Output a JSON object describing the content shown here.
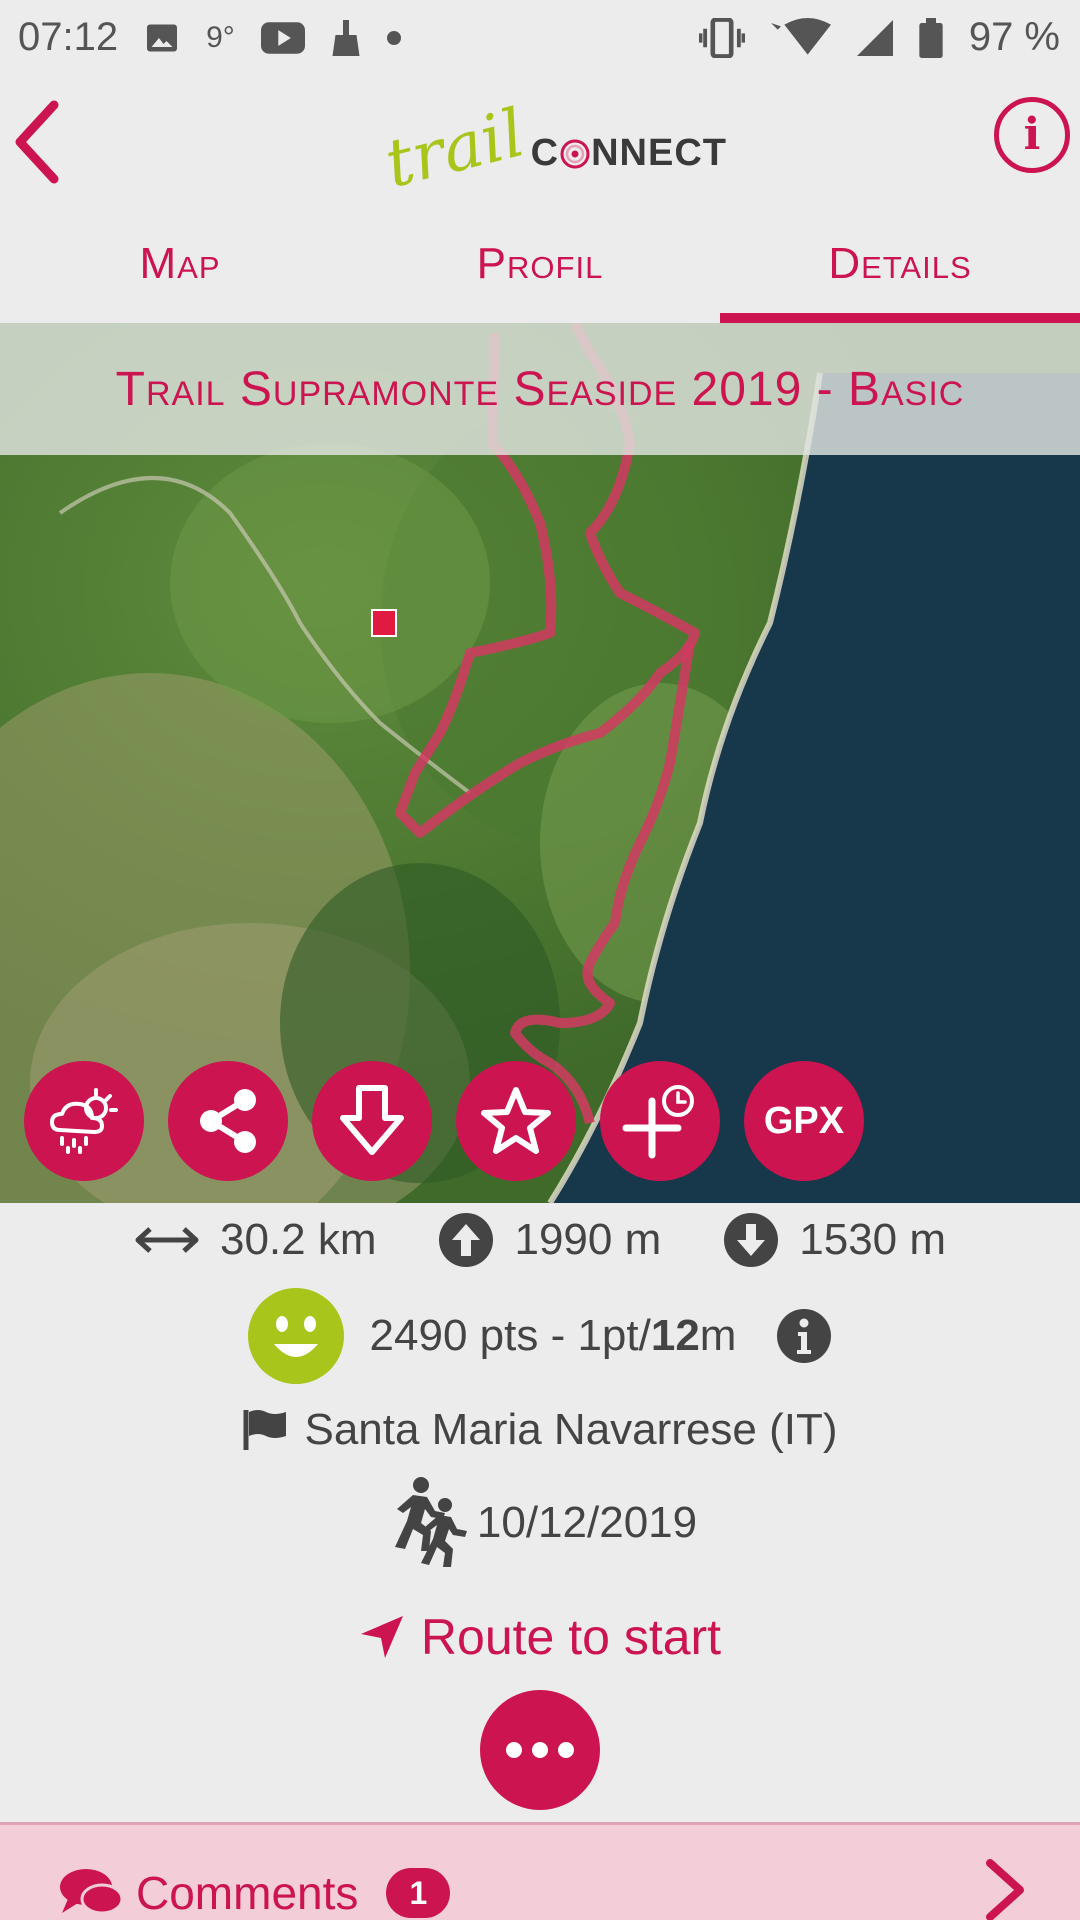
{
  "status_bar": {
    "time": "07:12",
    "temp": "9°",
    "battery": "97 %",
    "icons": [
      "image-icon",
      "youtube-icon",
      "cleaner-icon",
      "dot-icon",
      "vibrate-icon",
      "wifi-icon",
      "signal-icon",
      "battery-icon"
    ]
  },
  "header": {
    "logo_trail": "trail",
    "logo_connect_c": "C",
    "logo_connect_rest": "NNECT",
    "info_glyph": "i"
  },
  "tabs": [
    {
      "label": "Map",
      "active": false
    },
    {
      "label": "Profil",
      "active": false
    },
    {
      "label": "Details",
      "active": true
    }
  ],
  "trail": {
    "title": "Trail Supramonte Seaside 2019 - Basic"
  },
  "actions": {
    "gpx_label": "GPX",
    "icons": [
      "weather-icon",
      "share-icon",
      "download-icon",
      "favorite-star-icon",
      "add-reminder-icon",
      "gpx-icon"
    ]
  },
  "stats": {
    "distance": "30.2 km",
    "ascent": "1990 m",
    "descent": "1530 m"
  },
  "points": {
    "prefix": "2490 pts - 1pt/",
    "bold": "12",
    "suffix": "m"
  },
  "location": "Santa Maria Navarrese (IT)",
  "date": "10/12/2019",
  "route_to_start": "Route to start",
  "comments": {
    "label": "Comments",
    "count": "1"
  },
  "colors": {
    "accent": "#cc1450",
    "logo_green": "#a7c51a",
    "background": "#ececec",
    "comments_bg": "#f3cdd8",
    "smiley": "#a7c51a"
  }
}
